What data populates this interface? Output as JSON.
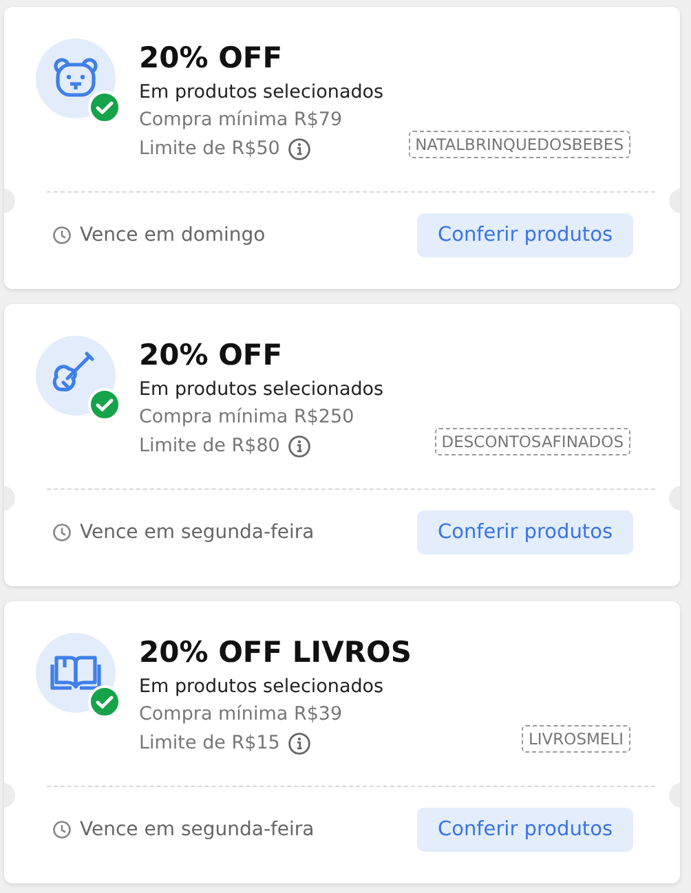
{
  "coupons": [
    {
      "kind": "bear",
      "activated": true,
      "title": "20% OFF",
      "subtitle": "Em produtos selecionados",
      "min_purchase": "Compra mínima R$79",
      "limit": "Limite de R$50",
      "code": "NATALBRINQUEDOSBEBES",
      "expiry": "Vence em domingo",
      "button": "Conferir produtos"
    },
    {
      "kind": "guitar",
      "activated": true,
      "title": "20% OFF",
      "subtitle": "Em produtos selecionados",
      "min_purchase": "Compra mínima R$250",
      "limit": "Limite de R$80",
      "code": "DESCONTOSAFINADOS",
      "expiry": "Vence em segunda-feira",
      "button": "Conferir produtos"
    },
    {
      "kind": "book",
      "activated": true,
      "title": "20% OFF LIVROS",
      "subtitle": "Em produtos selecionados",
      "min_purchase": "Compra mínima R$39",
      "limit": "Limite de R$15",
      "code": "LIVROSMELI",
      "expiry": "Vence em segunda-feira",
      "button": "Conferir produtos"
    }
  ]
}
